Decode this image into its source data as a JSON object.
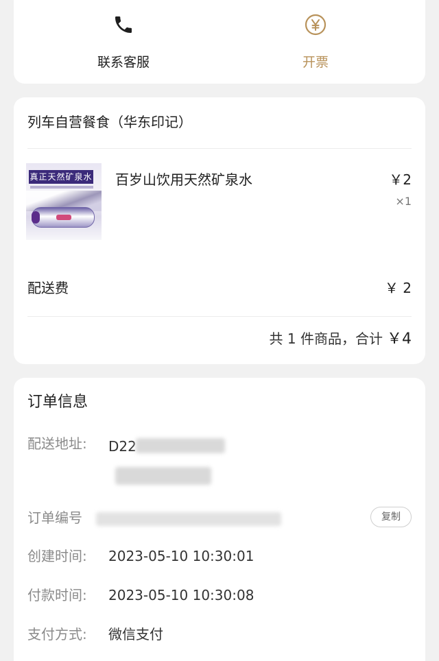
{
  "actions": {
    "service_label": "联系客服",
    "invoice_label": "开票",
    "invoice_color": "#b8925a"
  },
  "order": {
    "shop_name": "列车自营餐食（华东印记）",
    "product": {
      "name": "百岁山饮用天然矿泉水",
      "price": "￥2",
      "quantity": "×1",
      "image_caption": "真正天然矿泉水"
    },
    "delivery_fee": {
      "label": "配送费",
      "value": "￥ 2"
    },
    "summary": {
      "count_text": "共 1 件商品，合计",
      "total": "￥4"
    }
  },
  "info": {
    "title": "订单信息",
    "address": {
      "label": "配送地址:",
      "value": "D22"
    },
    "order_no": {
      "label": "订单编号",
      "copy_label": "复制"
    },
    "created": {
      "label": "创建时间:",
      "value": "2023-05-10 10:30:01"
    },
    "paid": {
      "label": "付款时间:",
      "value": "2023-05-10 10:30:08"
    },
    "payment": {
      "label": "支付方式:",
      "value": "微信支付"
    }
  },
  "icons": {
    "service": "phone-icon",
    "invoice": "yen-circle-icon"
  }
}
